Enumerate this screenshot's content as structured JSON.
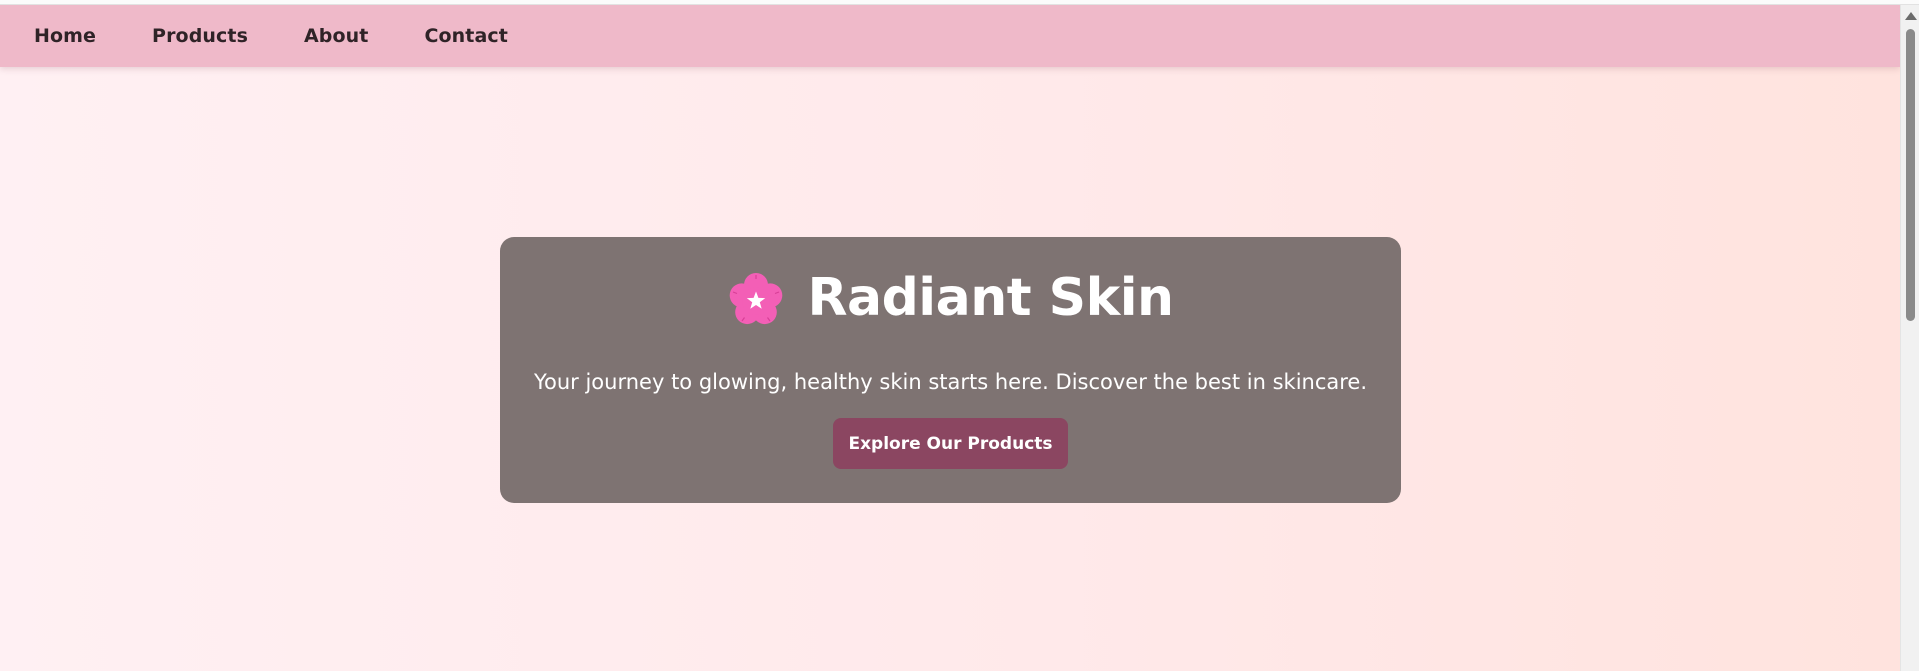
{
  "nav": {
    "items": [
      {
        "label": "Home"
      },
      {
        "label": "Products"
      },
      {
        "label": "About"
      },
      {
        "label": "Contact"
      }
    ]
  },
  "hero": {
    "icon": "cherry-blossom-icon",
    "title": "Radiant Skin",
    "subtitle": "Your journey to glowing, healthy skin starts here. Discover the best in skincare.",
    "cta_label": "Explore Our Products"
  },
  "colors": {
    "navbar_bg": "#efb9c9",
    "card_bg": "#7e7372",
    "button_bg": "#8b4661",
    "flower": "#f35fb6",
    "page_gradient_start": "#fff0f3",
    "page_gradient_end": "#ffe3de"
  }
}
